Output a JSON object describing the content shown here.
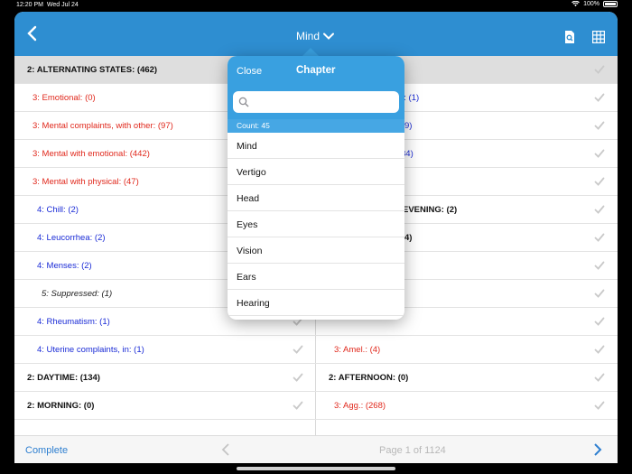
{
  "status": {
    "time": "12:20 PM",
    "date": "Wed Jul 24",
    "battery": "100%"
  },
  "navbar": {
    "title": "Mind"
  },
  "left_rows": [
    {
      "text": "2: ALTERNATING STATES: (462)",
      "style": "black",
      "indent": 14,
      "header": true
    },
    {
      "text": "3: Emotional: (0)",
      "style": "red",
      "indent": 20
    },
    {
      "text": "3: Mental complaints, with other: (97)",
      "style": "red",
      "indent": 20
    },
    {
      "text": "3: Mental with emotional: (442)",
      "style": "red",
      "indent": 20
    },
    {
      "text": "3: Mental with physical: (47)",
      "style": "red",
      "indent": 20
    },
    {
      "text": "4: Chill: (2)",
      "style": "blue",
      "indent": 25
    },
    {
      "text": "4: Leucorrhea: (2)",
      "style": "blue",
      "indent": 25
    },
    {
      "text": "4: Menses: (2)",
      "style": "blue",
      "indent": 25
    },
    {
      "text": "5: Suppressed: (1)",
      "style": "italic",
      "indent": 30
    },
    {
      "text": "4: Rheumatism: (1)",
      "style": "blue",
      "indent": 25
    },
    {
      "text": "4: Uterine complaints, in: (1)",
      "style": "blue",
      "indent": 25
    },
    {
      "text": "2: DAYTIME: (134)",
      "style": "black",
      "indent": 14
    },
    {
      "text": "2: MORNING: (0)",
      "style": "black",
      "indent": 14
    }
  ],
  "right_rows": [
    {
      "text": "",
      "style": "black",
      "indent": 14,
      "header": true
    },
    {
      "text": "e: (1)",
      "style": "blue",
      "indent": 92
    },
    {
      "text": "9)",
      "style": "blue",
      "indent": 98
    },
    {
      "text": "34)",
      "style": "blue",
      "indent": 94
    },
    {
      "text": "",
      "style": "black",
      "indent": 14
    },
    {
      "text": "EVENING: (2)",
      "style": "black",
      "indent": 96
    },
    {
      "text": "4)",
      "style": "black",
      "indent": 98
    },
    {
      "text": "",
      "style": "black",
      "indent": 14
    },
    {
      "text": "",
      "style": "black",
      "indent": 14
    },
    {
      "text": "",
      "style": "black",
      "indent": 14
    },
    {
      "text": "3: Amel.: (4)",
      "style": "red",
      "indent": 20
    },
    {
      "text": "2: AFTERNOON: (0)",
      "style": "black",
      "indent": 14
    },
    {
      "text": "3: Agg.: (268)",
      "style": "red",
      "indent": 20
    }
  ],
  "popover": {
    "close_label": "Close",
    "title": "Chapter",
    "search_placeholder": "",
    "count": "Count: 45",
    "items": [
      "Mind",
      "Vertigo",
      "Head",
      "Eyes",
      "Vision",
      "Ears",
      "Hearing"
    ]
  },
  "bottom": {
    "complete_label": "Complete",
    "page_label": "Page 1 of 1124"
  },
  "colors": {
    "accent": "#2e8ed1",
    "header_blue": "#39a0e0",
    "red": "#e0281c",
    "blue": "#1a2bd6"
  }
}
